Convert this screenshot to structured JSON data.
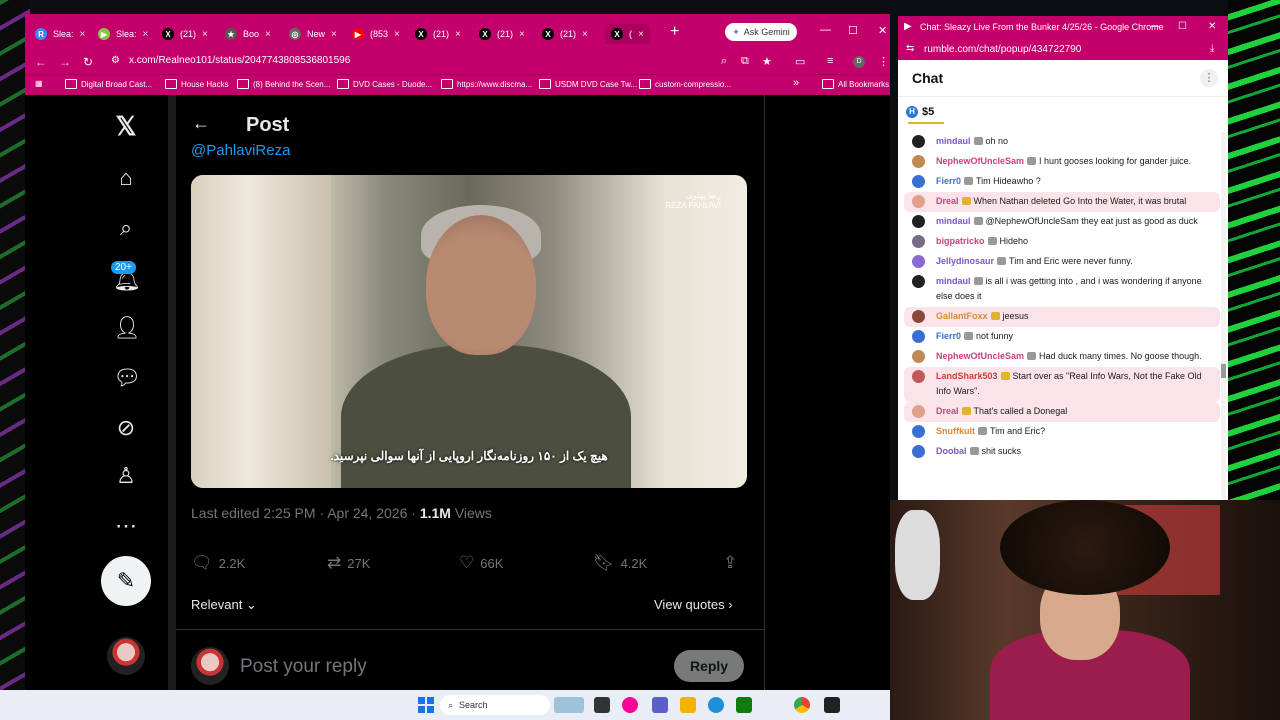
{
  "browser": {
    "tabs": [
      {
        "label": "Slea:",
        "icon": "R",
        "color": "#4285f4",
        "active": false
      },
      {
        "label": "Slea:",
        "icon": "▶",
        "color": "#85c742",
        "active": false
      },
      {
        "label": "(21)",
        "icon": "X",
        "color": "#000000",
        "active": false
      },
      {
        "label": "Boo",
        "icon": "★",
        "color": "#555555",
        "active": false
      },
      {
        "label": "New",
        "icon": "◎",
        "color": "#666666",
        "active": false
      },
      {
        "label": "(853",
        "icon": "▶",
        "color": "#ff0000",
        "active": false
      },
      {
        "label": "(21)",
        "icon": "X",
        "color": "#000000",
        "active": false
      },
      {
        "label": "(21)",
        "icon": "X",
        "color": "#000000",
        "active": false
      },
      {
        "label": "(21)",
        "icon": "X",
        "color": "#000000",
        "active": false
      },
      {
        "label": "(",
        "icon": "X",
        "color": "#000000",
        "active": true
      }
    ],
    "new_tab": "+",
    "gemini_label": "Ask Gemini",
    "url": "x.com/Realneo101/status/2047743808536801596",
    "profile_letter": "D",
    "bookmarks": [
      "Digital Broad Cast...",
      "House Hacks",
      "(8) Behind the Scen...",
      "DVD Cases - Duode...",
      "https://www.discma...",
      "USDM DVD Case Tw...",
      "custom-compressio..."
    ],
    "bookmarks_more": "»",
    "all_bookmarks": "All Bookmarks"
  },
  "x": {
    "notif_badge": "20+",
    "page_title": "Post",
    "handle": "@PahlaviReza",
    "video_logo_line1": "رضا پهلوی",
    "video_logo_line2": "REZA PAHLAVI",
    "subtitle": "هیچ یک از ۱۵۰ روزنامه‌نگار اروپایی از آنها سوالی نپرسید.",
    "edited": "Last edited 2:25 PM · Apr 24, 2026 · ",
    "views_count": "1.1M",
    "views_label": " Views",
    "replies": "2.2K",
    "reposts": "27K",
    "likes": "66K",
    "bookmarks": "4.2K",
    "relevant": "Relevant",
    "view_quotes": "View quotes",
    "reply_placeholder": "Post your reply",
    "reply_button": "Reply"
  },
  "taskbar": {
    "search": "Search"
  },
  "chat": {
    "window_title": "Chat: Sleazy Live From the Bunker 4/25/26 - Google Chrome",
    "url": "rumble.com/chat/popup/434722790",
    "header": "Chat",
    "rant_amount": "$5",
    "messages": [
      {
        "user": "mindaul",
        "color": "#7a55c9",
        "text": "oh no",
        "hl": false,
        "av": "#222222"
      },
      {
        "user": "NephewOfUncleSam",
        "color": "#c9417a",
        "text": "I hunt gooses looking for gander juice.",
        "hl": false,
        "av": "#c08a55"
      },
      {
        "user": "Fierr0",
        "color": "#3a6fd1",
        "text": "Tim Hideawho ?",
        "hl": false,
        "av": "#3a6fd1"
      },
      {
        "user": "Dreal",
        "color": "#c9417a",
        "text": "When Nathan deleted Go Into the Water, it was brutal",
        "hl": true,
        "av": "#e0a08a"
      },
      {
        "user": "mindaul",
        "color": "#7a55c9",
        "text": "@NephewOfUncleSam they eat just as good as duck",
        "hl": false,
        "av": "#222222"
      },
      {
        "user": "bigpatricko",
        "color": "#c9417a",
        "text": "Hideho",
        "hl": false,
        "av": "#7a6a8a"
      },
      {
        "user": "Jellydinosaur",
        "color": "#7a55c9",
        "text": "Tim and Eric were never funny.",
        "hl": false,
        "av": "#8a6ad1"
      },
      {
        "user": "mindaul",
        "color": "#7a55c9",
        "text": "is all i was getting into , and i was wondering if anyone else does it",
        "hl": false,
        "av": "#222222"
      },
      {
        "user": "GallantFoxx",
        "color": "#d98a3a",
        "text": "jeesus",
        "hl": true,
        "av": "#8a4a3a"
      },
      {
        "user": "Fierr0",
        "color": "#3a6fd1",
        "text": "not funny",
        "hl": false,
        "av": "#3a6fd1"
      },
      {
        "user": "NephewOfUncleSam",
        "color": "#c9417a",
        "text": "Had duck many times. No goose though.",
        "hl": false,
        "av": "#c08a55"
      },
      {
        "user": "LandShark503",
        "color": "#d13a3a",
        "text": "Start over as \"Real Info Wars, Not the Fake Old Info Wars\".",
        "hl": true,
        "av": "#c05a5a"
      },
      {
        "user": "Dreal",
        "color": "#c9417a",
        "text": "That's called a Donegal",
        "hl": true,
        "av": "#e0a08a"
      },
      {
        "user": "Snuffkult",
        "color": "#d98a3a",
        "text": "Tim and Eric?",
        "hl": false,
        "av": "#3a6fd1"
      },
      {
        "user": "Doobal",
        "color": "#7a55c9",
        "text": "shit sucks",
        "hl": false,
        "av": "#3a6fd1"
      }
    ]
  }
}
